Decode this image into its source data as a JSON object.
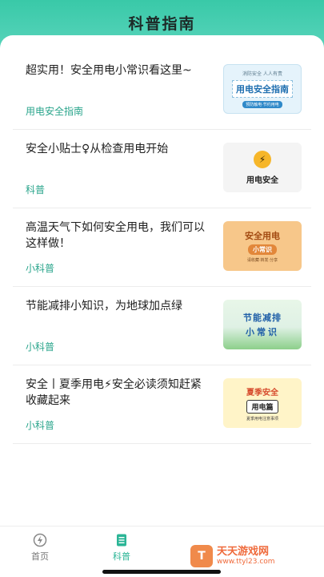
{
  "header": {
    "title": "科普指南"
  },
  "articles": [
    {
      "title": "超实用！安全用电小常识看这里~",
      "tag": "用电安全指南",
      "thumb": {
        "top": "消防安全 人人有责",
        "main": "用电安全指南",
        "pill": "预防触电·节约用电"
      }
    },
    {
      "title": "安全小贴士♀从检查用电开始",
      "tag": "科普",
      "thumb": {
        "icon": "lightbulb-icon",
        "glyph": "⚡",
        "caption": "用电安全"
      }
    },
    {
      "title": "高温天气下如何安全用电，我们可以这样做！",
      "tag": "小科普",
      "thumb": {
        "main": "安全用电",
        "band": "小常识",
        "note": "请收藏·转发·分享"
      }
    },
    {
      "title": "节能减排小知识，为地球加点绿",
      "tag": "小科普",
      "thumb": {
        "main": "节能减排",
        "sub": "小常识"
      }
    },
    {
      "title": "安全丨夏季用电⚡安全必读须知赶紧收藏起来",
      "tag": "小科普",
      "thumb": {
        "main": "夏季安全",
        "sub": "用电篇",
        "note": "夏季用电注意事项"
      }
    }
  ],
  "tabbar": {
    "home": {
      "label": "首页",
      "icon": "lightning-circle-icon"
    },
    "science": {
      "label": "科普",
      "icon": "document-icon",
      "active": true
    }
  },
  "watermark": {
    "logo": "T",
    "name": "天天游戏网",
    "url": "www.ttyl23.com"
  },
  "colors": {
    "accent": "#2bb596",
    "header": "#39c9a8"
  }
}
